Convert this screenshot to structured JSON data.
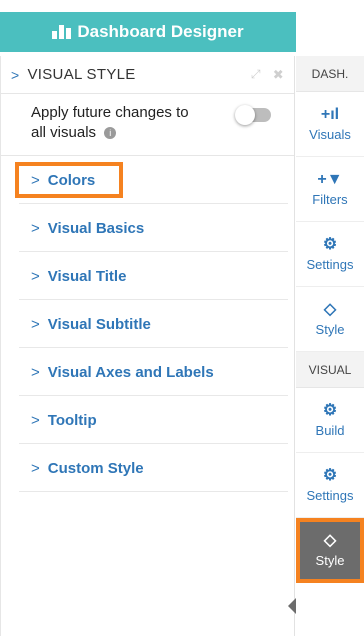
{
  "header": {
    "title": "Dashboard Designer",
    "icon": "dashboard-icon"
  },
  "panel": {
    "chevron": ">",
    "title": "VISUAL STYLE",
    "expand_icon": "expand-icon",
    "close_icon": "close-icon",
    "apply": {
      "line1": "Apply future changes to",
      "line2": "all visuals",
      "toggle_on": false
    }
  },
  "sections": [
    {
      "chevron": ">",
      "label": "Colors"
    },
    {
      "chevron": ">",
      "label": "Visual Basics"
    },
    {
      "chevron": ">",
      "label": "Visual Title"
    },
    {
      "chevron": ">",
      "label": "Visual Subtitle"
    },
    {
      "chevron": ">",
      "label": "Visual Axes and Labels"
    },
    {
      "chevron": ">",
      "label": "Tooltip"
    },
    {
      "chevron": ">",
      "label": "Custom Style"
    }
  ],
  "sidebar": {
    "dash_label": "DASH.",
    "dash_items": [
      {
        "icon": "+ıl",
        "label": "Visuals"
      },
      {
        "icon": "+▼",
        "label": "Filters"
      },
      {
        "icon": "⚙",
        "label": "Settings"
      },
      {
        "icon": "◇",
        "label": "Style"
      }
    ],
    "visual_label": "VISUAL",
    "visual_items": [
      {
        "icon": "⚙",
        "label": "Build"
      },
      {
        "icon": "⚙",
        "label": "Settings"
      },
      {
        "icon": "◇",
        "label": "Style"
      }
    ]
  },
  "colors": {
    "teal": "#4bbfbf",
    "blue": "#2f76b7",
    "orange": "#f58220",
    "active_gray": "#6c6c6c"
  }
}
